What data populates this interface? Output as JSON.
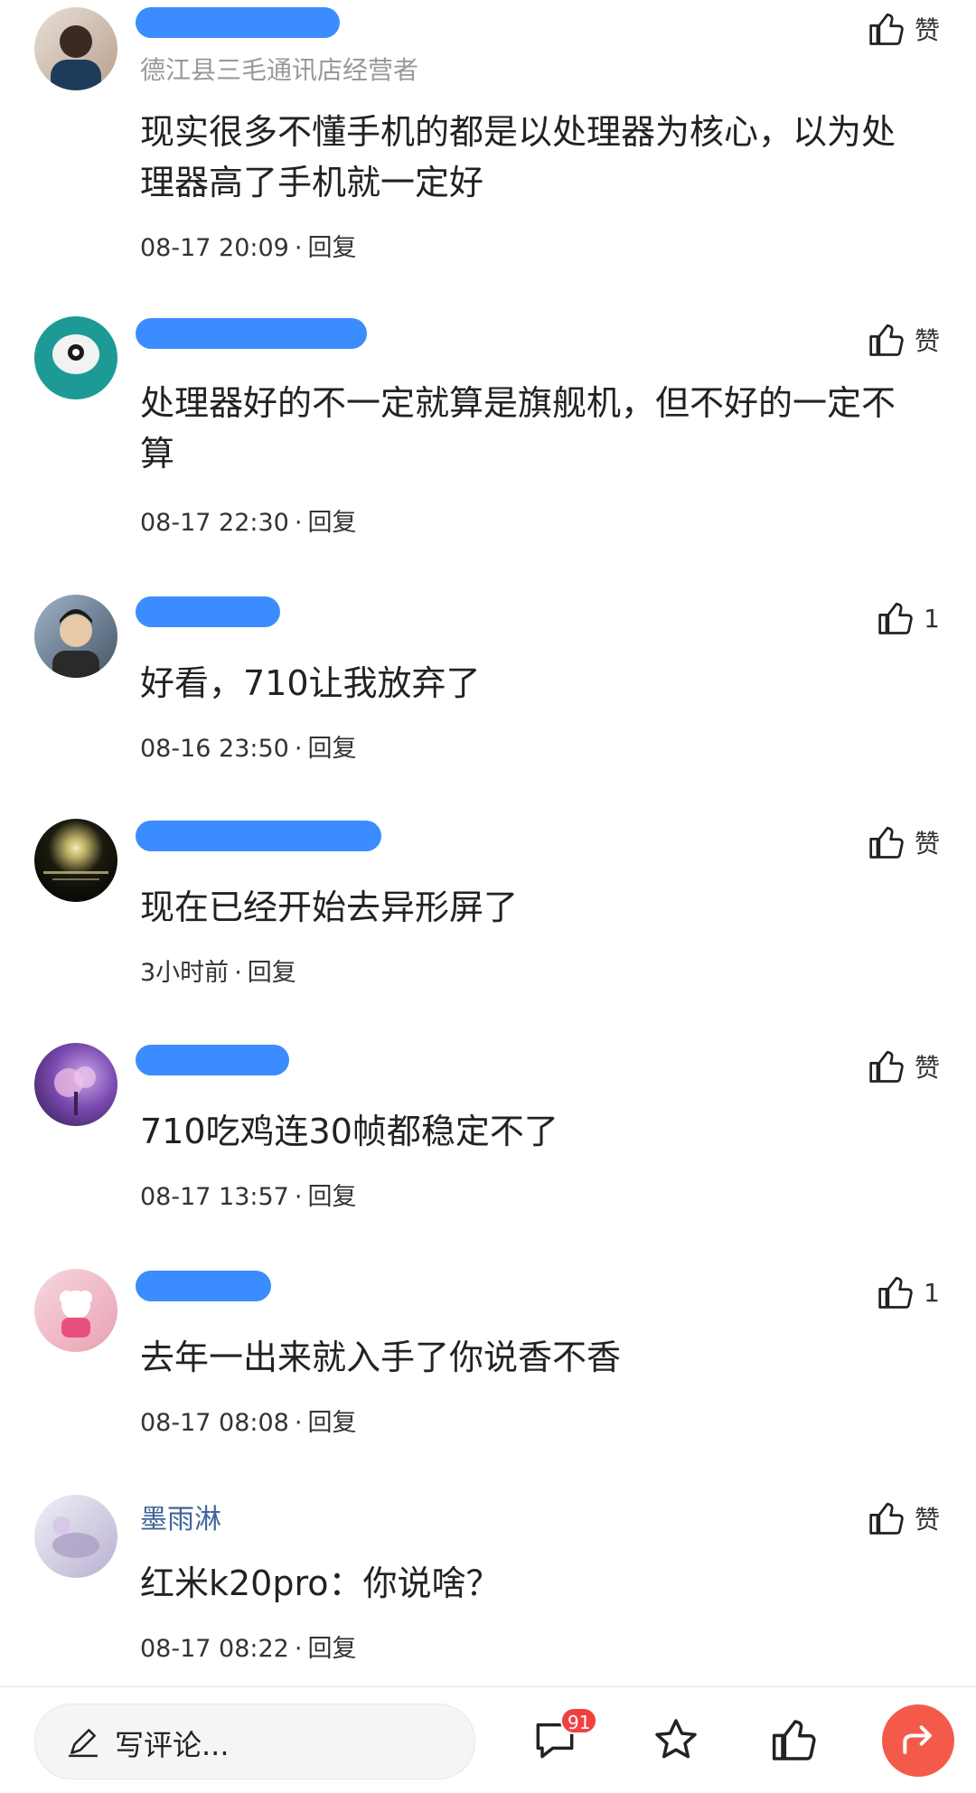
{
  "comments": [
    {
      "subtitle": "德江县三毛通讯店经营者",
      "text": "现实很多不懂手机的都是以处理器为核心，以为处理器高了手机就一定好",
      "time": "08-17 20:09",
      "reply_label": "回复",
      "like_label": "赞",
      "avatar_color": "#c7b8ad"
    },
    {
      "text": "处理器好的不一定就算是旗舰机，但不好的一定不算",
      "time": "08-17 22:30",
      "reply_label": "回复",
      "like_label": "赞",
      "avatar_color": "#1e9a96"
    },
    {
      "text": "好看，710让我放弃了",
      "time": "08-16 23:50",
      "reply_label": "回复",
      "like_label": "1",
      "avatar_color": "#556677"
    },
    {
      "text": "现在已经开始去异形屏了",
      "time": "3小时前",
      "reply_label": "回复",
      "like_label": "赞",
      "avatar_color": "#222211"
    },
    {
      "text": "710吃鸡连30帧都稳定不了",
      "time": "08-17 13:57",
      "reply_label": "回复",
      "like_label": "赞",
      "avatar_color": "#6b3a9a"
    },
    {
      "text": "去年一出来就入手了你说香不香",
      "time": "08-17 08:08",
      "reply_label": "回复",
      "like_label": "1",
      "avatar_color": "#f0b8c4"
    },
    {
      "username": "墨雨淋",
      "text": "红米k20pro：你说啥？",
      "time": "08-17 08:22",
      "reply_label": "回复",
      "like_label": "赞",
      "avatar_color": "#d8d8e8"
    }
  ],
  "bottom_bar": {
    "write_placeholder": "写评论...",
    "comment_count": "91",
    "icons": [
      "pencil-icon",
      "comment-icon",
      "star-icon",
      "thumbs-up-icon",
      "share-icon"
    ],
    "share_color": "#f45a4a",
    "badge_color": "#f04142"
  },
  "colors": {
    "username_blur": "#3b8cff",
    "username_link": "#406599"
  }
}
